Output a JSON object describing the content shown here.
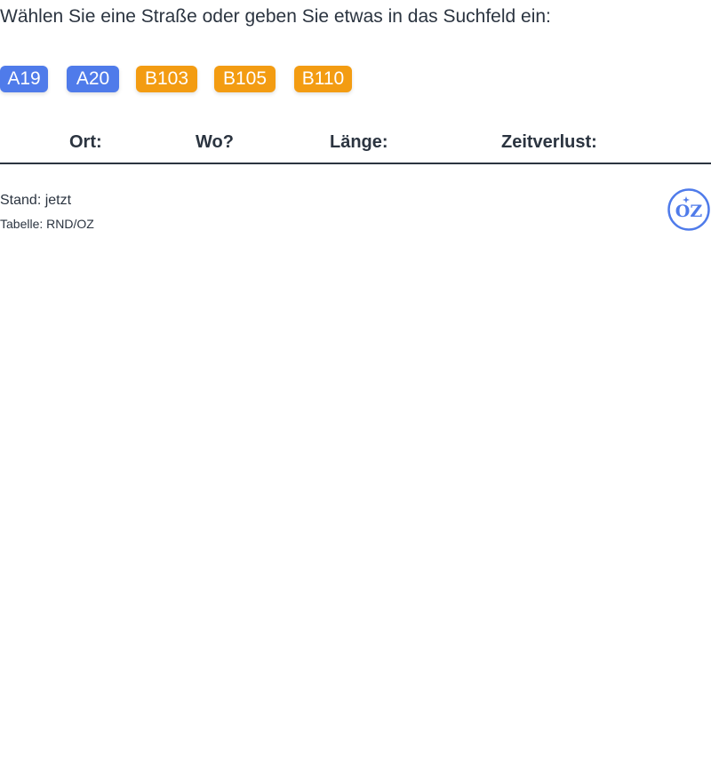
{
  "prompt": "Wählen Sie eine Straße oder geben Sie etwas in das Suchfeld ein:",
  "roads": [
    {
      "label": "A19",
      "color": "#4f7bea"
    },
    {
      "label": "A20",
      "color": "#4f7bea"
    },
    {
      "label": "B103",
      "color": "#f39c12"
    },
    {
      "label": "B105",
      "color": "#f39c12"
    },
    {
      "label": "B110",
      "color": "#f39c12"
    }
  ],
  "table": {
    "columns": [
      "Ort:",
      "Wo?",
      "Länge:",
      "Zeitverlust:"
    ],
    "rows": []
  },
  "footer": {
    "stand": "Stand: jetzt",
    "source": "Tabelle: RND/OZ"
  },
  "logo": {
    "text": "OZ",
    "icon": "oz-logo-icon",
    "color": "#4f7bea"
  }
}
